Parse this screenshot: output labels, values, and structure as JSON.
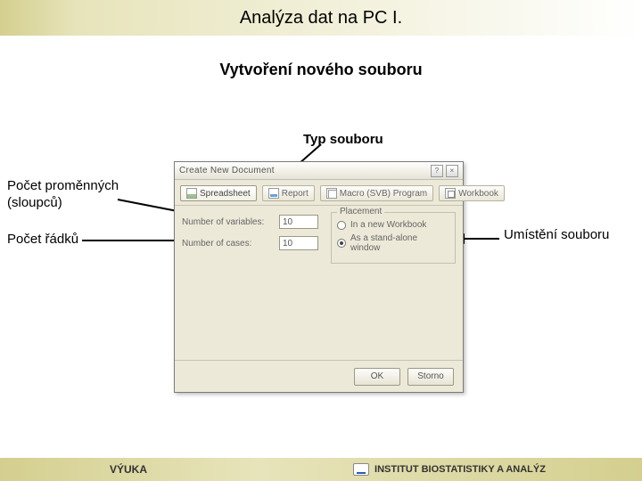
{
  "header": {
    "title": "Analýza dat na PC I."
  },
  "subtitle": "Vytvoření nového souboru",
  "annotations": {
    "file_type": "Typ souboru",
    "var_count": "Počet proměnných (sloupců)",
    "row_count": "Počet řádků",
    "placement": "Umístění souboru"
  },
  "dialog": {
    "title": "Create New Document",
    "tabs": {
      "spreadsheet": "Spreadsheet",
      "report": "Report",
      "macro": "Macro (SVB) Program",
      "workbook": "Workbook"
    },
    "fields": {
      "vars_label": "Number of variables:",
      "vars_value": "10",
      "cases_label": "Number of cases:",
      "cases_value": "10"
    },
    "placement": {
      "group": "Placement",
      "opt1": "In a new Workbook",
      "opt2": "As a stand-alone window"
    },
    "buttons": {
      "ok": "OK",
      "cancel": "Storno"
    }
  },
  "footer": {
    "left": "VÝUKA",
    "right": "INSTITUT BIOSTATISTIKY A ANALÝZ"
  }
}
